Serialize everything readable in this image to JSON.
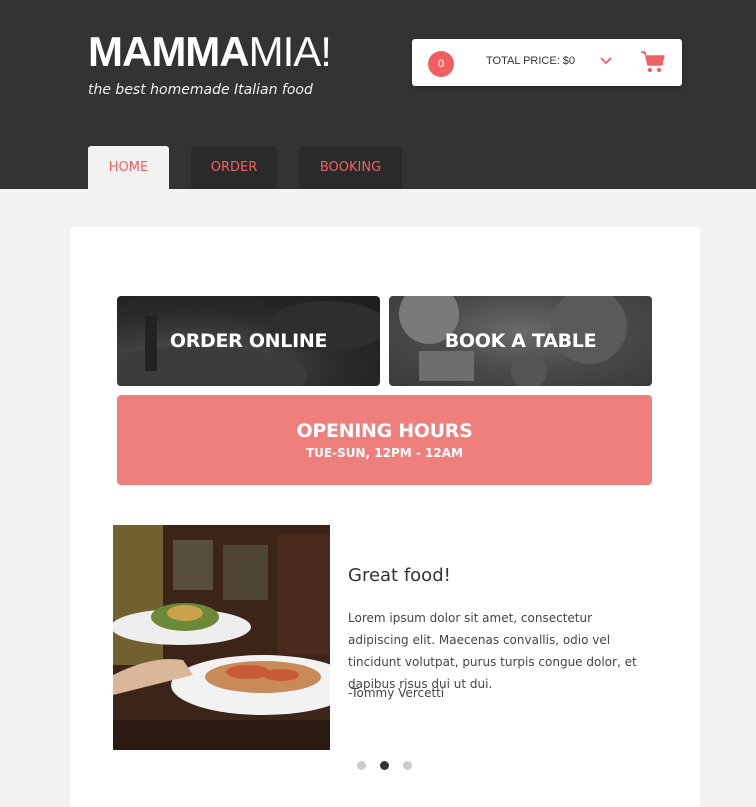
{
  "header": {
    "logo_bold": "MAMMA",
    "logo_light": "MIA!",
    "tagline": "the best homemade Italian food"
  },
  "cart": {
    "count": "0",
    "total_label": "TOTAL PRICE: $0",
    "chevron_icon": "chevron-down-icon",
    "cart_icon": "shopping-cart-icon"
  },
  "nav": {
    "tabs": [
      {
        "label": "HOME",
        "active": true
      },
      {
        "label": "ORDER",
        "active": false
      },
      {
        "label": "BOOKING",
        "active": false
      }
    ]
  },
  "tiles": {
    "order": "ORDER ONLINE",
    "book": "BOOK A TABLE",
    "hours_title": "OPENING HOURS",
    "hours_sub": "TUE-SUN, 12PM - 12AM"
  },
  "testimonial": {
    "title": "Great food!",
    "body": "Lorem ipsum dolor sit amet, consectetur adipiscing elit. Maecenas convallis, odio vel tincidunt volutpat, purus turpis congue dolor, et dapibus risus dui ut dui.",
    "author": "-Tommy Vercetti"
  },
  "carousel": {
    "active_index": 1,
    "count": 3
  },
  "colors": {
    "accent": "#f06060",
    "header_bg": "#333333",
    "hours_bg": "#ef7f7c"
  }
}
